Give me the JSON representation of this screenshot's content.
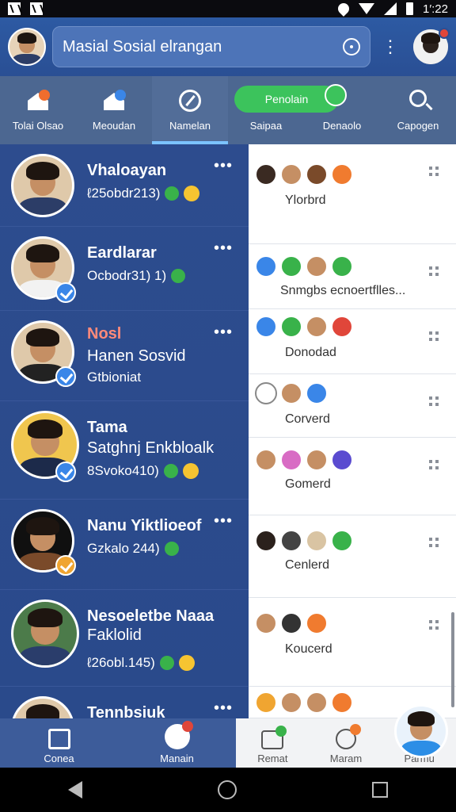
{
  "status": {
    "time": "1′:22"
  },
  "header": {
    "search_text": "Masial Sosial elrangan"
  },
  "tabs": [
    {
      "label": "Tolai Olsao",
      "icon": "home-icon"
    },
    {
      "label": "Meoudan",
      "icon": "home-icon"
    },
    {
      "label": "Namelan",
      "icon": "compass-icon"
    },
    {
      "label": "Saipaa",
      "icon": "chat-icon"
    },
    {
      "label": "Denaolo",
      "icon": "none"
    },
    {
      "label": "Capogen",
      "icon": "search-icon"
    }
  ],
  "pill": {
    "label": "Penolain"
  },
  "chats": [
    {
      "name": "Vhaloayan",
      "line2": "",
      "sub": "ℓ25obdr213)",
      "verified": "none"
    },
    {
      "name": "Eardlarar",
      "line2": "",
      "sub": "Ocbodr31) 1)",
      "verified": "blue"
    },
    {
      "name": "Nosl",
      "line2": "Hanen Sosvid",
      "sub": "Gtbioniat",
      "verified": "blue"
    },
    {
      "name": "Tama",
      "line2": "Satghnj Enkbloalk",
      "sub": "8Svoko410)",
      "verified": "blue"
    },
    {
      "name": "Nanu Yiktlioeof",
      "line2": "",
      "sub": "Gzkalo 244)",
      "verified": "orange"
    },
    {
      "name": "Nesoeletbe Naaa",
      "line2": "Faklolid",
      "sub": "ℓ26obl.145)",
      "verified": "none"
    },
    {
      "name": "Tennbsiuk",
      "line2": "",
      "sub": "",
      "verified": "blue"
    }
  ],
  "panel_rows": [
    {
      "label": "Ylorbrd"
    },
    {
      "label": "Snmgbs ecnoertflles..."
    },
    {
      "label": "Donodad"
    },
    {
      "label": "Corverd"
    },
    {
      "label": "Gomerd"
    },
    {
      "label": "Cenlerd"
    },
    {
      "label": "Koucerd"
    },
    {
      "label": ""
    }
  ],
  "bottom_left": [
    {
      "label": "Conea",
      "icon": "news-icon"
    },
    {
      "label": "Manain",
      "icon": "bunny-icon"
    }
  ],
  "bottom_right": [
    {
      "label": "Remat",
      "icon": "camera-icon"
    },
    {
      "label": "Maram",
      "icon": "clock-icon"
    },
    {
      "label": "Parmu",
      "icon": "avatar"
    }
  ],
  "colors": {
    "primary": "#2d5aa3",
    "green": "#3cc35c",
    "accent": "#7cc3ff"
  }
}
